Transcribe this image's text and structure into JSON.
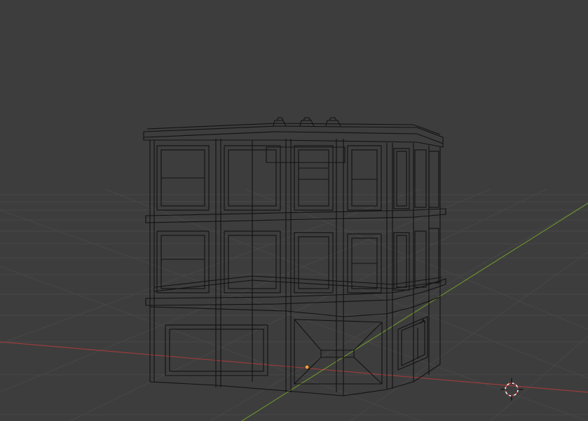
{
  "viewport": {
    "background_color": "#3d3d3d",
    "grid_color": "#474747",
    "x_axis_color": "#9a3c3c",
    "y_axis_color": "#6b8e2f",
    "wire_color": "#121212",
    "origin_color": "#e8a13a",
    "cursor_color": "#ffffff",
    "cursor_accent": "#d23a3a"
  },
  "icons": {
    "object_origin": "origin-dot-icon",
    "cursor": "3d-cursor-icon"
  }
}
